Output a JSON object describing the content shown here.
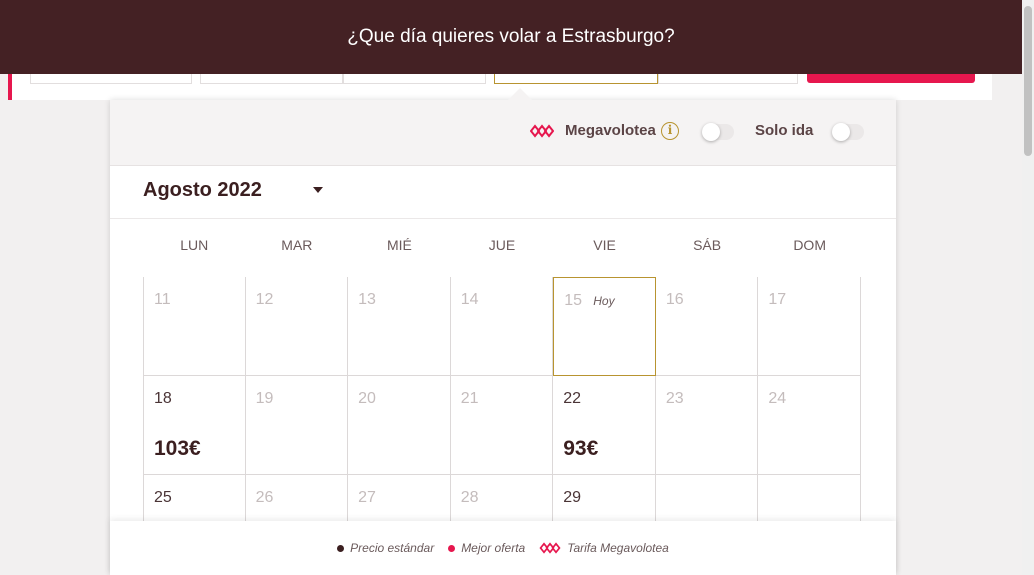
{
  "banner": {
    "title": "¿Que día quieres volar a Estrasburgo?"
  },
  "toggles": {
    "megavolotea_label": "Megavolotea",
    "info_symbol": "i",
    "solo_ida_label": "Solo ida",
    "megavolotea_on": false,
    "solo_ida_on": false
  },
  "calendar": {
    "month_label": "Agosto 2022",
    "weekdays": [
      "LUN",
      "MAR",
      "MIÉ",
      "JUE",
      "VIE",
      "SÁB",
      "DOM"
    ],
    "today_label": "Hoy",
    "weeks": [
      [
        {
          "day": "11",
          "price": ""
        },
        {
          "day": "12",
          "price": ""
        },
        {
          "day": "13",
          "price": ""
        },
        {
          "day": "14",
          "price": ""
        },
        {
          "day": "15",
          "price": "",
          "today": true
        },
        {
          "day": "16",
          "price": ""
        },
        {
          "day": "17",
          "price": ""
        }
      ],
      [
        {
          "day": "18",
          "price": "103€",
          "available": true
        },
        {
          "day": "19",
          "price": ""
        },
        {
          "day": "20",
          "price": ""
        },
        {
          "day": "21",
          "price": ""
        },
        {
          "day": "22",
          "price": "93€",
          "available": true
        },
        {
          "day": "23",
          "price": ""
        },
        {
          "day": "24",
          "price": ""
        }
      ],
      [
        {
          "day": "25",
          "price": "",
          "available": true
        },
        {
          "day": "26",
          "price": ""
        },
        {
          "day": "27",
          "price": ""
        },
        {
          "day": "28",
          "price": ""
        },
        {
          "day": "29",
          "price": "",
          "available": true
        },
        {
          "day": "",
          "price": ""
        },
        {
          "day": "",
          "price": ""
        }
      ]
    ]
  },
  "legend": {
    "standard": "Precio estándar",
    "best": "Mejor oferta",
    "megavolotea": "Tarifa Megavolotea"
  },
  "colors": {
    "banner_bg": "#442124",
    "accent_pink": "#e6174e",
    "gold": "#b89430",
    "dark_text": "#3b1f20"
  }
}
